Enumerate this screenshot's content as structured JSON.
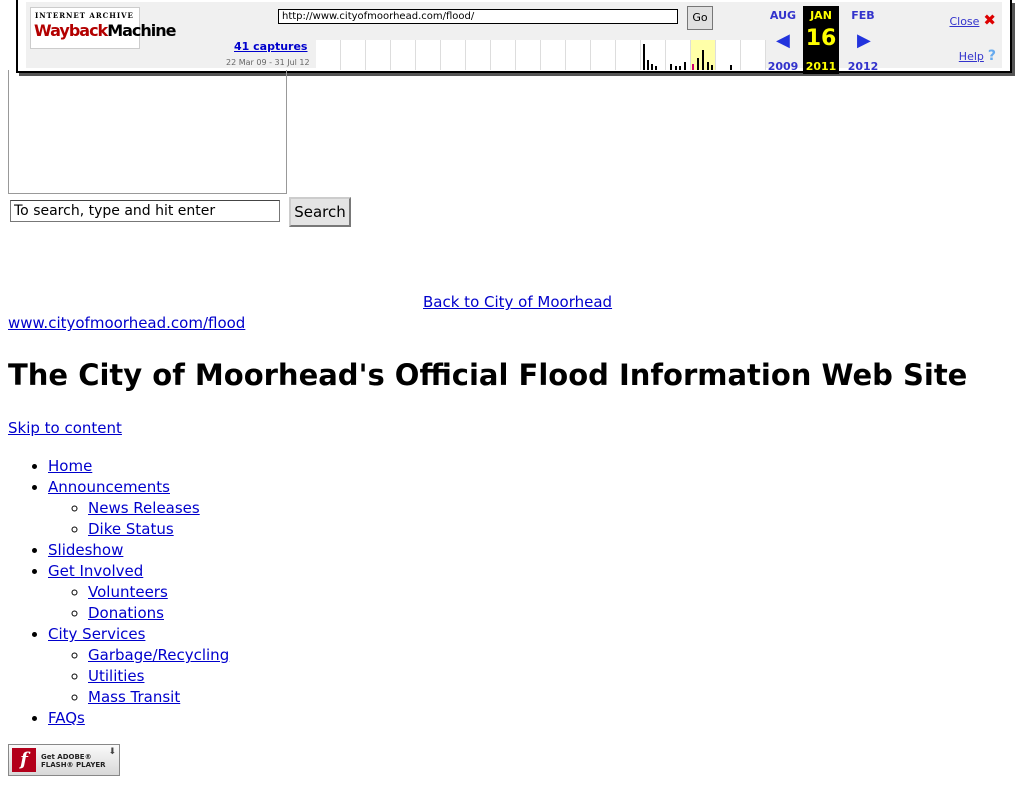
{
  "wayback": {
    "logo_top": "INTERNET ARCHIVE",
    "logo_bottom_a": "Wayback",
    "logo_bottom_b": "Machine",
    "url": "http://www.cityofmoorhead.com/flood/",
    "go_label": "Go",
    "captures": "41 captures",
    "range": "22 Mar 09 - 31 Jul 12",
    "prev_month": "AUG",
    "prev_year": "2009",
    "cur_month": "JAN",
    "cur_day": "16",
    "cur_year": "2011",
    "next_month": "FEB",
    "next_year": "2012",
    "close_label": "Close",
    "help_label": "Help"
  },
  "search": {
    "placeholder": "To search, type and hit enter",
    "button_label": "Search"
  },
  "links": {
    "back": "Back to City of Moorhead",
    "site": "www.cityofmoorhead.com/flood",
    "skip": "Skip to content"
  },
  "page_title": "The City of Moorhead's Official Flood Information Web Site",
  "nav": [
    {
      "label": "Home",
      "children": []
    },
    {
      "label": "Announcements",
      "children": [
        "News Releases",
        "Dike Status"
      ]
    },
    {
      "label": "Slideshow",
      "children": []
    },
    {
      "label": "Get Involved",
      "children": [
        "Volunteers",
        "Donations"
      ]
    },
    {
      "label": "City Services",
      "children": [
        "Garbage/Recycling",
        "Utilities",
        "Mass Transit"
      ]
    },
    {
      "label": "FAQs",
      "children": []
    }
  ],
  "flash": {
    "line1": "Get ADOBE®",
    "line2": "FLASH® PLAYER"
  },
  "colors": {
    "link": "#0000cc",
    "wayback_accent": "#3333cc",
    "current_date_bg": "#000000",
    "current_date_fg": "#ffff00",
    "close_x": "#dd0000"
  }
}
